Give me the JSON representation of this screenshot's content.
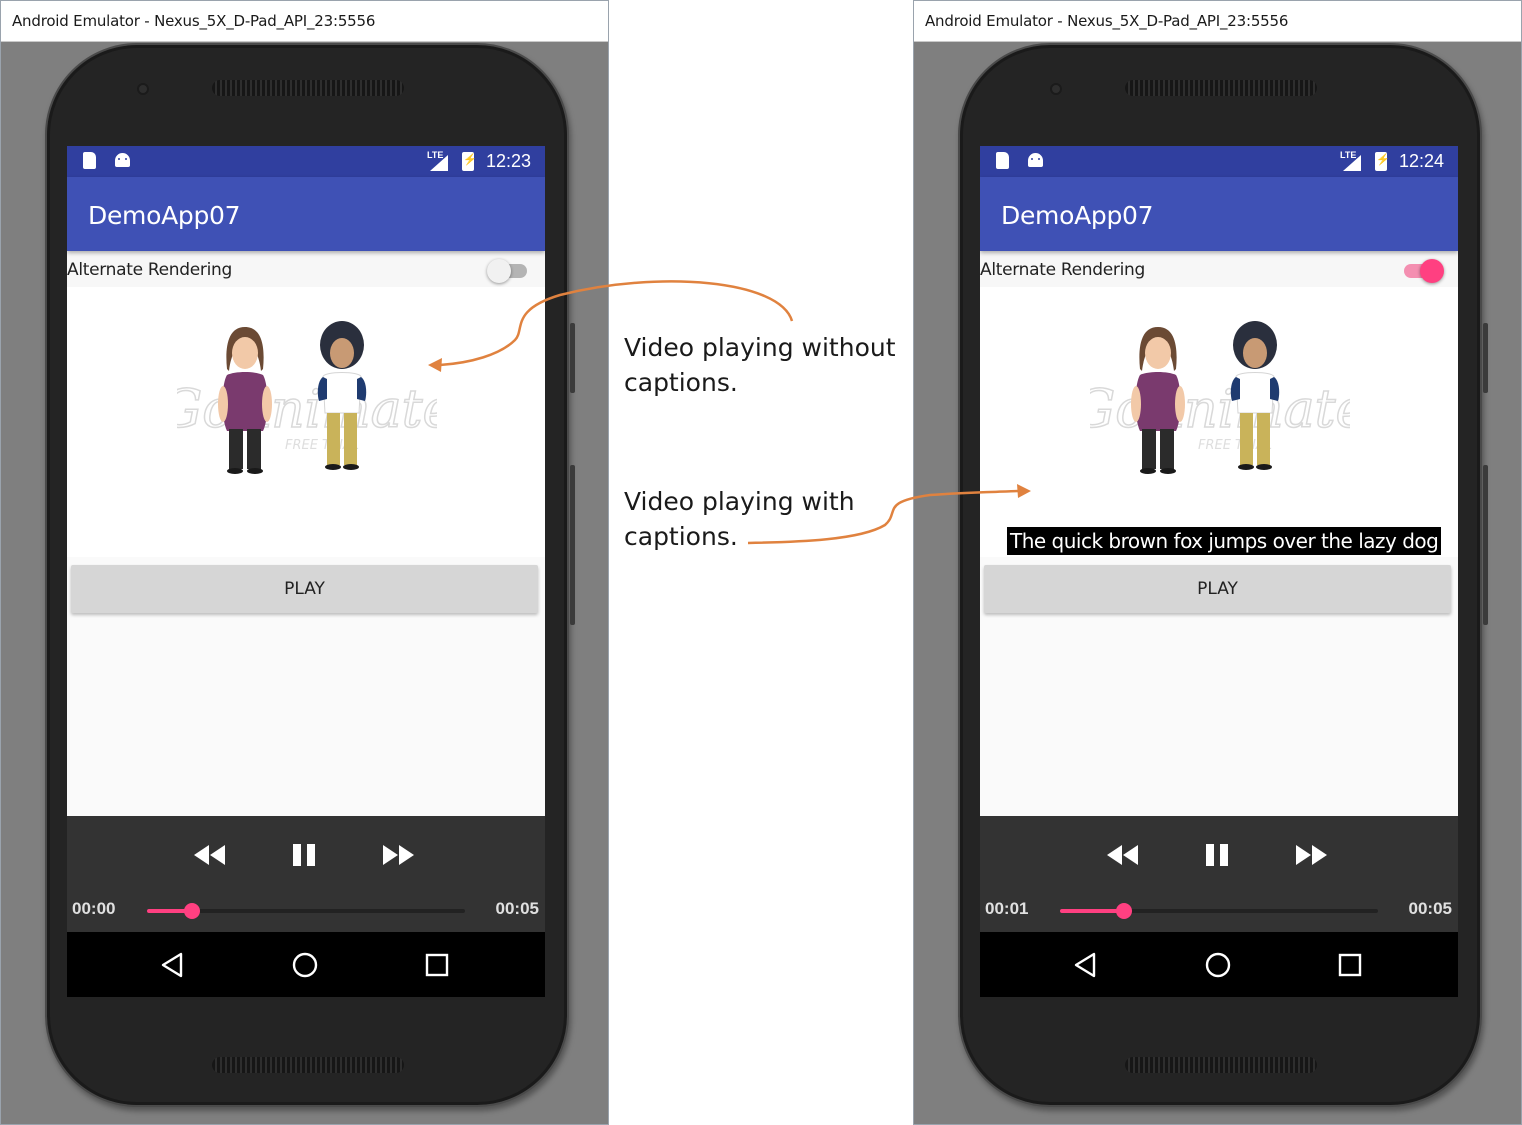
{
  "emulators": [
    {
      "window_title": "Android Emulator - Nexus_5X_D-Pad_API_23:5556",
      "status_time": "12:23",
      "status_lte": "LTE",
      "app_title": "DemoApp07",
      "toggle_label": "Alternate Rendering",
      "toggle_on": false,
      "caption": "",
      "play_label": "PLAY",
      "current_time": "00:00",
      "total_time": "00:05",
      "progress": 0.14,
      "watermark": "GoAnimate",
      "watermark_sub": "FREE TRIAL"
    },
    {
      "window_title": "Android Emulator - Nexus_5X_D-Pad_API_23:5556",
      "status_time": "12:24",
      "status_lte": "LTE",
      "app_title": "DemoApp07",
      "toggle_label": "Alternate Rendering",
      "toggle_on": true,
      "caption": "The quick brown fox jumps over the lazy dog",
      "play_label": "PLAY",
      "current_time": "00:01",
      "total_time": "00:05",
      "progress": 0.2,
      "watermark": "GoAnimate",
      "watermark_sub": "FREE TRIAL"
    }
  ],
  "annotations": {
    "without_captions": [
      "Video playing without",
      "captions."
    ],
    "with_captions": [
      "Video playing with",
      "captions."
    ]
  },
  "colors": {
    "status_bar": "#303f9f",
    "app_bar": "#3f51b5",
    "accent": "#ff4081",
    "arrow": "#e0823f",
    "controls_bg": "#333333"
  }
}
